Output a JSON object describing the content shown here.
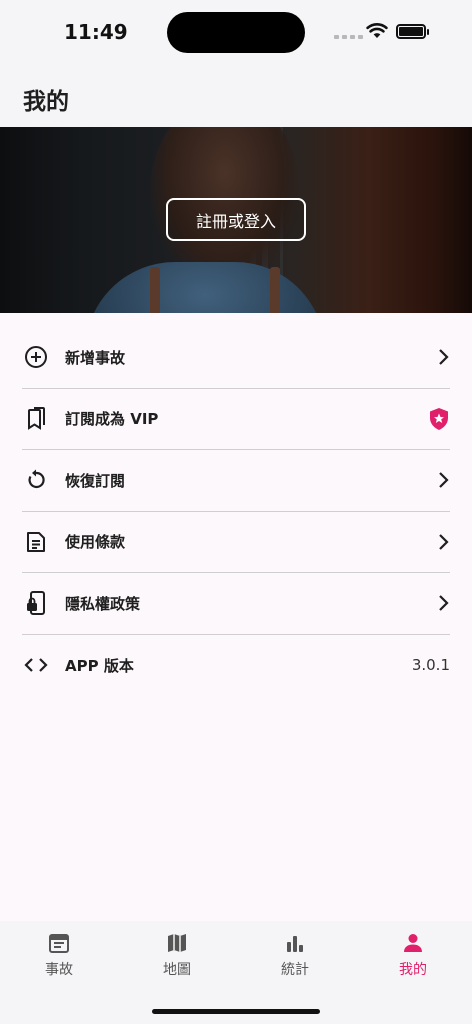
{
  "status_bar": {
    "time": "11:49"
  },
  "header": {
    "title": "我的"
  },
  "hero": {
    "login_label": "註冊或登入"
  },
  "menu": [
    {
      "label": "新增事故",
      "icon": "plus-circle-icon",
      "right": "chevron-right-icon"
    },
    {
      "label": "訂閱成為 VIP",
      "icon": "bookmarks-icon",
      "right": "vip-badge-icon"
    },
    {
      "label": "恢復訂閱",
      "icon": "refresh-icon",
      "right": "chevron-right-icon"
    },
    {
      "label": "使用條款",
      "icon": "document-icon",
      "right": "chevron-right-icon"
    },
    {
      "label": "隱私權政策",
      "icon": "phone-lock-icon",
      "right": "chevron-right-icon"
    },
    {
      "label": "APP 版本",
      "icon": "code-icon",
      "value": "3.0.1"
    }
  ],
  "tabs": [
    {
      "label": "事故",
      "icon": "calendar-icon"
    },
    {
      "label": "地圖",
      "icon": "map-icon"
    },
    {
      "label": "統計",
      "icon": "bar-chart-icon"
    },
    {
      "label": "我的",
      "icon": "person-icon",
      "active": true
    }
  ],
  "colors": {
    "accent": "#e0206a",
    "text": "#1f1f1f",
    "divider": "#cfcfcf",
    "background": "#fdf8fb"
  }
}
